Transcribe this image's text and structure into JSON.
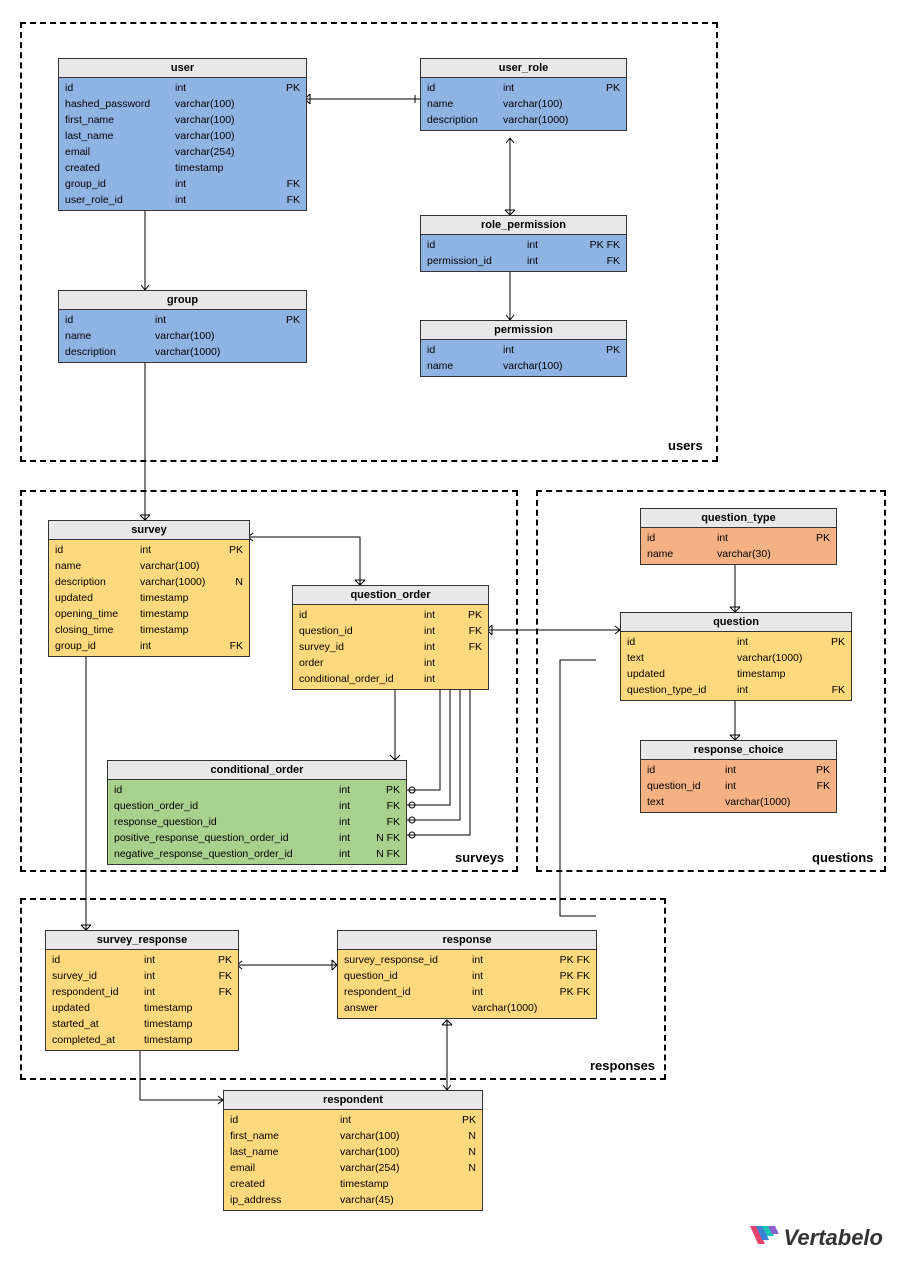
{
  "groups": {
    "users": {
      "label": "users"
    },
    "surveys": {
      "label": "surveys"
    },
    "questions": {
      "label": "questions"
    },
    "responses": {
      "label": "responses"
    }
  },
  "tables": {
    "user": {
      "name": "user",
      "cols": [
        {
          "n": "id",
          "t": "int",
          "k": "PK"
        },
        {
          "n": "hashed_password",
          "t": "varchar(100)",
          "k": ""
        },
        {
          "n": "first_name",
          "t": "varchar(100)",
          "k": ""
        },
        {
          "n": "last_name",
          "t": "varchar(100)",
          "k": ""
        },
        {
          "n": "email",
          "t": "varchar(254)",
          "k": ""
        },
        {
          "n": "created",
          "t": "timestamp",
          "k": ""
        },
        {
          "n": "group_id",
          "t": "int",
          "k": "FK"
        },
        {
          "n": "user_role_id",
          "t": "int",
          "k": "FK"
        }
      ]
    },
    "user_role": {
      "name": "user_role",
      "cols": [
        {
          "n": "id",
          "t": "int",
          "k": "PK"
        },
        {
          "n": "name",
          "t": "varchar(100)",
          "k": ""
        },
        {
          "n": "description",
          "t": "varchar(1000)",
          "k": ""
        }
      ]
    },
    "role_permission": {
      "name": "role_permission",
      "cols": [
        {
          "n": "id",
          "t": "int",
          "k": "PK FK"
        },
        {
          "n": "permission_id",
          "t": "int",
          "k": "FK"
        }
      ]
    },
    "permission": {
      "name": "permission",
      "cols": [
        {
          "n": "id",
          "t": "int",
          "k": "PK"
        },
        {
          "n": "name",
          "t": "varchar(100)",
          "k": ""
        }
      ]
    },
    "group": {
      "name": "group",
      "cols": [
        {
          "n": "id",
          "t": "int",
          "k": "PK"
        },
        {
          "n": "name",
          "t": "varchar(100)",
          "k": ""
        },
        {
          "n": "description",
          "t": "varchar(1000)",
          "k": ""
        }
      ]
    },
    "survey": {
      "name": "survey",
      "cols": [
        {
          "n": "id",
          "t": "int",
          "k": "PK"
        },
        {
          "n": "name",
          "t": "varchar(100)",
          "k": ""
        },
        {
          "n": "description",
          "t": "varchar(1000)",
          "k": "N"
        },
        {
          "n": "updated",
          "t": "timestamp",
          "k": ""
        },
        {
          "n": "opening_time",
          "t": "timestamp",
          "k": ""
        },
        {
          "n": "closing_time",
          "t": "timestamp",
          "k": ""
        },
        {
          "n": "group_id",
          "t": "int",
          "k": "FK"
        }
      ]
    },
    "question_order": {
      "name": "question_order",
      "cols": [
        {
          "n": "id",
          "t": "int",
          "k": "PK"
        },
        {
          "n": "question_id",
          "t": "int",
          "k": "FK"
        },
        {
          "n": "survey_id",
          "t": "int",
          "k": "FK"
        },
        {
          "n": "order",
          "t": "int",
          "k": ""
        },
        {
          "n": "conditional_order_id",
          "t": "int",
          "k": ""
        }
      ]
    },
    "conditional_order": {
      "name": "conditional_order",
      "cols": [
        {
          "n": "id",
          "t": "int",
          "k": "PK"
        },
        {
          "n": "question_order_id",
          "t": "int",
          "k": "FK"
        },
        {
          "n": "response_question_id",
          "t": "int",
          "k": "FK"
        },
        {
          "n": "positive_response_question_order_id",
          "t": "int",
          "k": "N FK"
        },
        {
          "n": "negative_response_question_order_id",
          "t": "int",
          "k": "N FK"
        }
      ]
    },
    "question_type": {
      "name": "question_type",
      "cols": [
        {
          "n": "id",
          "t": "int",
          "k": "PK"
        },
        {
          "n": "name",
          "t": "varchar(30)",
          "k": ""
        }
      ]
    },
    "question": {
      "name": "question",
      "cols": [
        {
          "n": "id",
          "t": "int",
          "k": "PK"
        },
        {
          "n": "text",
          "t": "varchar(1000)",
          "k": ""
        },
        {
          "n": "updated",
          "t": "timestamp",
          "k": ""
        },
        {
          "n": "question_type_id",
          "t": "int",
          "k": "FK"
        }
      ]
    },
    "response_choice": {
      "name": "response_choice",
      "cols": [
        {
          "n": "id",
          "t": "int",
          "k": "PK"
        },
        {
          "n": "question_id",
          "t": "int",
          "k": "FK"
        },
        {
          "n": "text",
          "t": "varchar(1000)",
          "k": ""
        }
      ]
    },
    "survey_response": {
      "name": "survey_response",
      "cols": [
        {
          "n": "id",
          "t": "int",
          "k": "PK"
        },
        {
          "n": "survey_id",
          "t": "int",
          "k": "FK"
        },
        {
          "n": "respondent_id",
          "t": "int",
          "k": "FK"
        },
        {
          "n": "updated",
          "t": "timestamp",
          "k": ""
        },
        {
          "n": "started_at",
          "t": "timestamp",
          "k": ""
        },
        {
          "n": "completed_at",
          "t": "timestamp",
          "k": ""
        }
      ]
    },
    "response": {
      "name": "response",
      "cols": [
        {
          "n": "survey_response_id",
          "t": "int",
          "k": "PK FK"
        },
        {
          "n": "question_id",
          "t": "int",
          "k": "PK FK"
        },
        {
          "n": "respondent_id",
          "t": "int",
          "k": "PK FK"
        },
        {
          "n": "answer",
          "t": "varchar(1000)",
          "k": ""
        }
      ]
    },
    "respondent": {
      "name": "respondent",
      "cols": [
        {
          "n": "id",
          "t": "int",
          "k": "PK"
        },
        {
          "n": "first_name",
          "t": "varchar(100)",
          "k": "N"
        },
        {
          "n": "last_name",
          "t": "varchar(100)",
          "k": "N"
        },
        {
          "n": "email",
          "t": "varchar(254)",
          "k": "N"
        },
        {
          "n": "created",
          "t": "timestamp",
          "k": ""
        },
        {
          "n": "ip_address",
          "t": "varchar(45)",
          "k": ""
        }
      ]
    }
  },
  "logo": "Vertabelo"
}
